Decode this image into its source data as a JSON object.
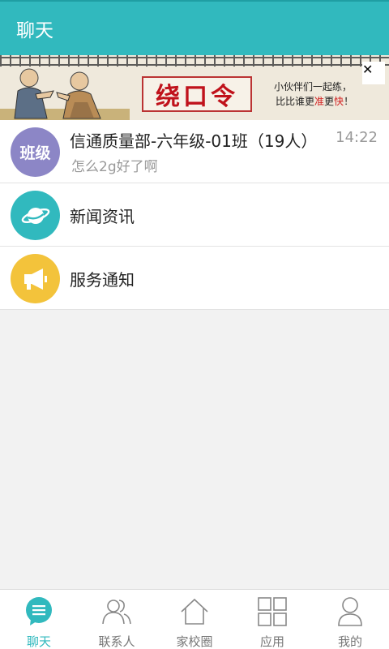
{
  "header": {
    "title": "聊天"
  },
  "banner": {
    "title": "绕口令",
    "slogan_line1": "小伙伴们一起练，",
    "slogan_line2_prefix": "比比谁更",
    "slogan_red1": "准",
    "slogan_mid": "更",
    "slogan_red2": "快",
    "slogan_suffix": "！",
    "close_glyph": "✕",
    "close_color": "#31b9be"
  },
  "chats": [
    {
      "avatar_text": "班级",
      "avatar_color": "#8c86c6",
      "name": "信通质量部-六年级-01班（19人）",
      "preview": "怎么2g好了啊",
      "time": "14:22"
    },
    {
      "avatar_icon": "planet-icon",
      "avatar_color": "#31b9be",
      "name": "新闻资讯"
    },
    {
      "avatar_icon": "megaphone-icon",
      "avatar_color": "#f3c33b",
      "name": "服务通知"
    }
  ],
  "nav": [
    {
      "label": "聊天",
      "icon": "chat-icon",
      "active": true
    },
    {
      "label": "联系人",
      "icon": "contacts-icon",
      "active": false
    },
    {
      "label": "家校圈",
      "icon": "home-icon",
      "active": false
    },
    {
      "label": "应用",
      "icon": "apps-grid-icon",
      "active": false
    },
    {
      "label": "我的",
      "icon": "person-icon",
      "active": false
    }
  ],
  "colors": {
    "primary": "#31b9be",
    "nav_inactive": "#777777",
    "background": "#f2f2f2"
  }
}
